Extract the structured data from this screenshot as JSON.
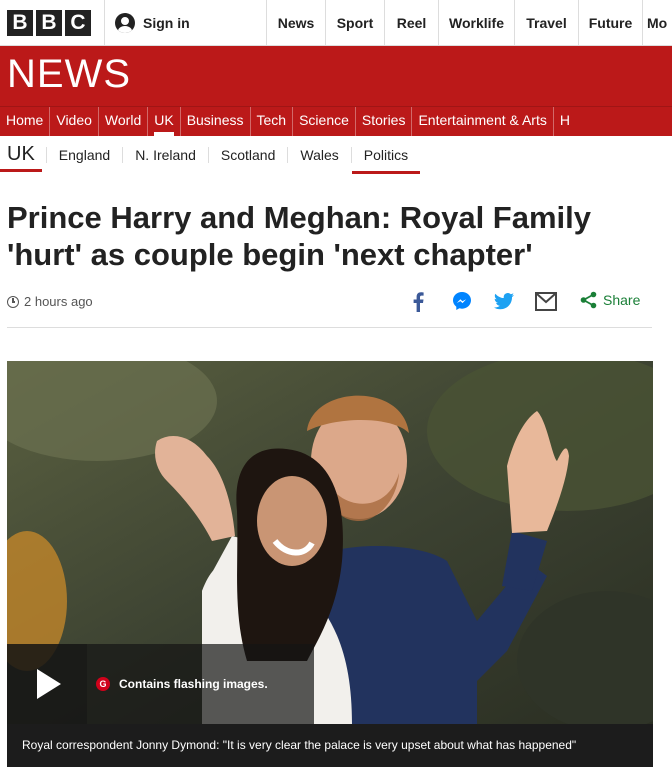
{
  "brand": {
    "letters": [
      "B",
      "B",
      "C"
    ],
    "news_wordmark": "NEWS"
  },
  "account": {
    "signin_label": "Sign in",
    "icon": "user-icon"
  },
  "top_nav": {
    "items": [
      {
        "label": "News"
      },
      {
        "label": "Sport"
      },
      {
        "label": "Reel"
      },
      {
        "label": "Worklife"
      },
      {
        "label": "Travel"
      },
      {
        "label": "Future"
      },
      {
        "label": "Mo"
      }
    ]
  },
  "section_nav": {
    "items": [
      {
        "label": "Home",
        "active": false
      },
      {
        "label": "Video",
        "active": false
      },
      {
        "label": "World",
        "active": false
      },
      {
        "label": "UK",
        "active": true
      },
      {
        "label": "Business",
        "active": false
      },
      {
        "label": "Tech",
        "active": false
      },
      {
        "label": "Science",
        "active": false
      },
      {
        "label": "Stories",
        "active": false
      },
      {
        "label": "Entertainment & Arts",
        "active": false
      },
      {
        "label": "H",
        "active": false
      }
    ]
  },
  "sub_nav": {
    "current": "UK",
    "items": [
      {
        "label": "England",
        "active": false
      },
      {
        "label": "N. Ireland",
        "active": false
      },
      {
        "label": "Scotland",
        "active": false
      },
      {
        "label": "Wales",
        "active": false
      },
      {
        "label": "Politics",
        "active": true
      }
    ]
  },
  "article": {
    "headline": "Prince Harry and Meghan: Royal Family 'hurt' as couple begin 'next chapter'",
    "timestamp": "2 hours ago",
    "share_label": "Share",
    "share_icons": [
      "facebook-icon",
      "messenger-icon",
      "twitter-icon",
      "email-icon",
      "share-icon"
    ]
  },
  "media": {
    "warning_badge": "G",
    "warning_text": "Contains flashing images.",
    "caption": "Royal correspondent Jonny Dymond: \"It is very clear the palace is very upset about what has happened\""
  },
  "colors": {
    "brand_red": "#bb1919",
    "facebook_blue": "#3b5998",
    "messenger_blue": "#0084ff",
    "twitter_blue": "#1da1f2",
    "share_green": "#1a7f37"
  }
}
